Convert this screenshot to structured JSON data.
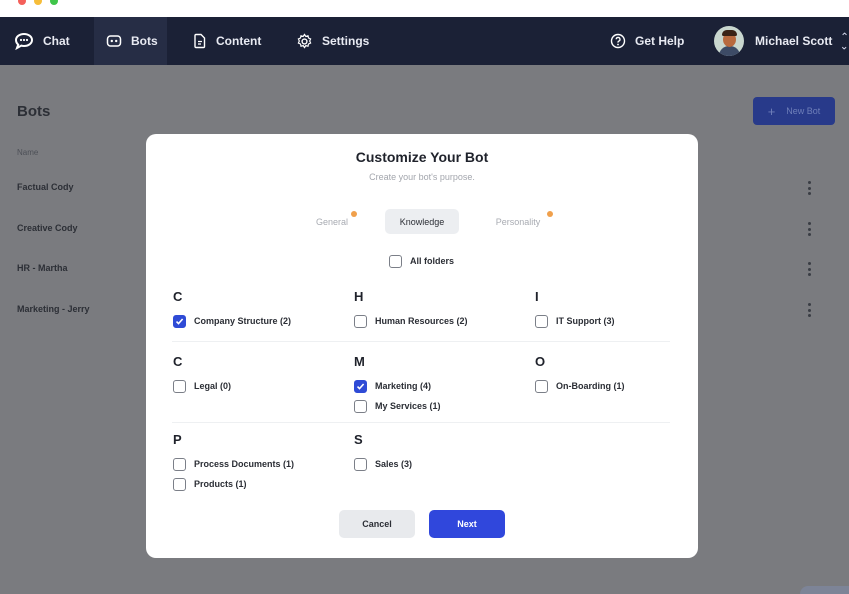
{
  "nav": {
    "items": [
      {
        "label": "Chat",
        "icon": "chat-bubble-icon"
      },
      {
        "label": "Bots",
        "icon": "bot-icon",
        "active": true
      },
      {
        "label": "Content",
        "icon": "document-icon"
      },
      {
        "label": "Settings",
        "icon": "gear-icon"
      }
    ],
    "help_label": "Get Help",
    "user_name": "Michael Scott"
  },
  "page": {
    "title": "Bots",
    "column_header": "Name",
    "new_bot_label": "New Bot",
    "bots": [
      "Factual Cody",
      "Creative Cody",
      "HR - Martha",
      "Marketing - Jerry"
    ]
  },
  "modal": {
    "title": "Customize Your Bot",
    "subtitle": "Create your bot's purpose.",
    "tabs": [
      {
        "label": "General",
        "indicator": true
      },
      {
        "label": "Knowledge",
        "active": true
      },
      {
        "label": "Personality",
        "indicator": true
      }
    ],
    "all_folders_label": "All folders",
    "all_folders_checked": false,
    "groups": [
      {
        "letter": "C",
        "folders": [
          {
            "label": "Company Structure (2)",
            "checked": true
          }
        ]
      },
      {
        "letter": "H",
        "folders": [
          {
            "label": "Human Resources (2)",
            "checked": false
          }
        ]
      },
      {
        "letter": "I",
        "folders": [
          {
            "label": "IT Support (3)",
            "checked": false
          }
        ]
      },
      {
        "letter": "C",
        "folders": [
          {
            "label": "Legal (0)",
            "checked": false
          }
        ]
      },
      {
        "letter": "M",
        "folders": [
          {
            "label": "Marketing (4)",
            "checked": true
          },
          {
            "label": "My Services (1)",
            "checked": false
          }
        ]
      },
      {
        "letter": "O",
        "folders": [
          {
            "label": "On-Boarding (1)",
            "checked": false
          }
        ]
      },
      {
        "letter": "P",
        "folders": [
          {
            "label": "Process Documents (1)",
            "checked": false
          },
          {
            "label": "Products (1)",
            "checked": false
          }
        ]
      },
      {
        "letter": "S",
        "folders": [
          {
            "label": "Sales (3)",
            "checked": false
          }
        ]
      }
    ],
    "cancel_label": "Cancel",
    "next_label": "Next"
  },
  "colors": {
    "nav_bg": "#1b2136",
    "accent": "#3047dc",
    "indicator": "#f0a04b",
    "overlay_bg": "#7a7b7f"
  }
}
